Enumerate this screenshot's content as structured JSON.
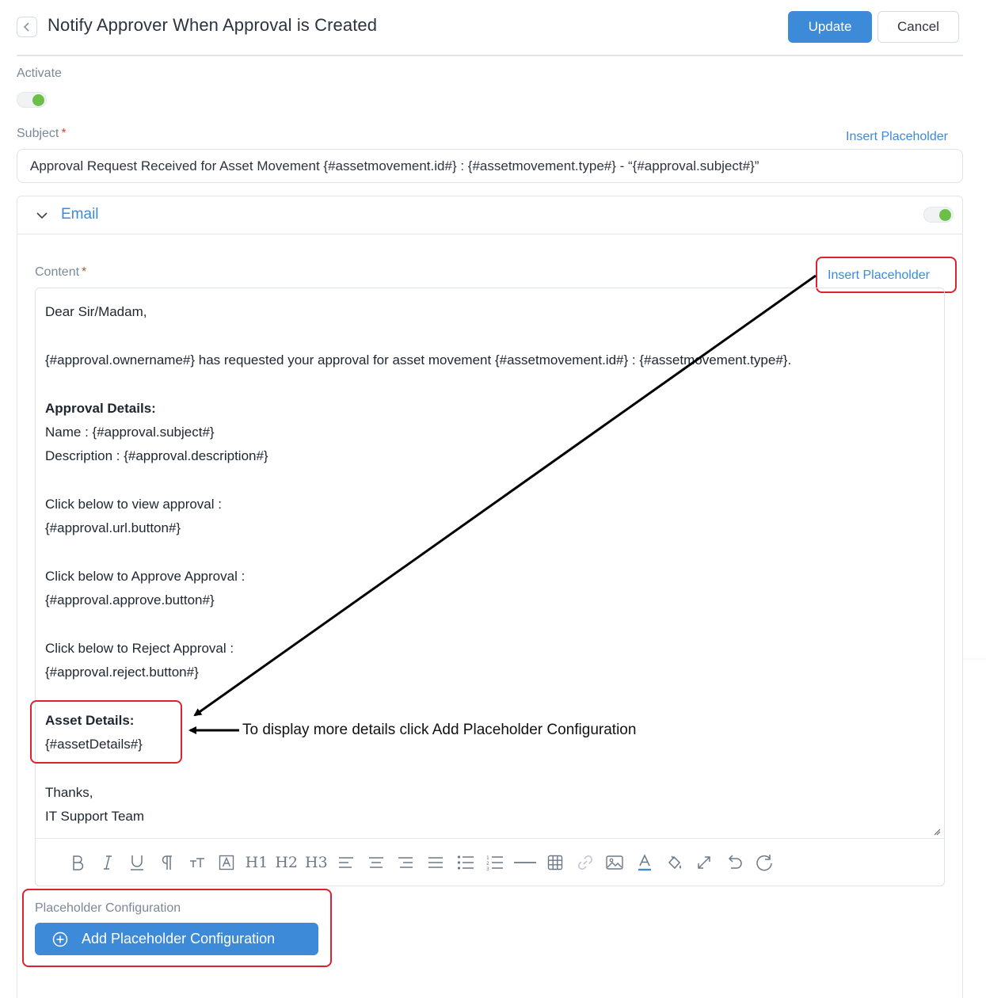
{
  "header": {
    "title": "Notify Approver When Approval is Created",
    "update_label": "Update",
    "cancel_label": "Cancel"
  },
  "activate": {
    "label": "Activate",
    "enabled": true
  },
  "subject": {
    "label": "Subject",
    "required_mark": "*",
    "insert_placeholder": "Insert Placeholder",
    "value": "Approval Request Received for Asset Movement {#assetmovement.id#} : {#assetmovement.type#} - “{#approval.subject#}”"
  },
  "email": {
    "title": "Email",
    "enabled": true,
    "content_label": "Content",
    "required_mark": "*",
    "insert_placeholder": "Insert Placeholder",
    "body": {
      "greeting": "Dear Sir/Madam,",
      "intro": "{#approval.ownername#} has requested your approval for asset movement {#assetmovement.id#} : {#assetmovement.type#}.",
      "approval_details_heading": "Approval Details:",
      "name_line": "Name : {#approval.subject#}",
      "description_line": "Description : {#approval.description#}",
      "view_label": "Click below to view approval :",
      "view_placeholder": "{#approval.url.button#}",
      "approve_label": "Click below to Approve Approval :",
      "approve_placeholder": "{#approval.approve.button#}",
      "reject_label": "Click below to Reject Approval :",
      "reject_placeholder": " {#approval.reject.button#}",
      "asset_heading": "Asset Details:",
      "asset_placeholder": " {#assetDetails#}",
      "thanks": "Thanks,",
      "signature": "IT Support Team"
    },
    "toolbar": [
      "bold",
      "italic",
      "underline",
      "paragraph",
      "font-size",
      "text-box",
      "H1",
      "H2",
      "H3",
      "align-left",
      "align-center",
      "align-right",
      "align-justify",
      "bullet-list",
      "numbered-list",
      "horizontal-rule",
      "table",
      "link",
      "image",
      "font-color",
      "fill-color",
      "fullscreen",
      "undo",
      "redo"
    ],
    "toolbar_labels": {
      "h1": "H1",
      "h2": "H2",
      "h3": "H3"
    }
  },
  "placeholder_config": {
    "label": "Placeholder Configuration",
    "add_button": "Add Placeholder Configuration"
  },
  "annotation": {
    "text": "To display more details click Add Placeholder Configuration",
    "highlight_color": "#d9232e"
  },
  "colors": {
    "accent": "#3d8ad8",
    "toggle_on": "#6cc04a",
    "required": "#e0453a"
  }
}
